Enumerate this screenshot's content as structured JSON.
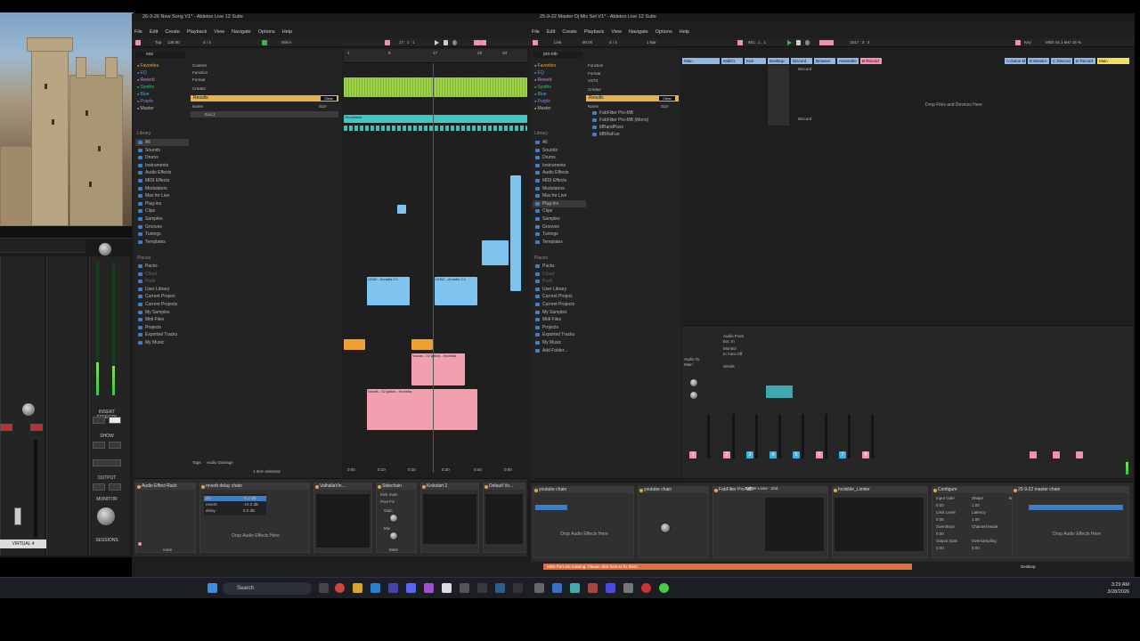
{
  "left_window": {
    "title": "26-3-26 New Song V1* - Ableton Live 12 Suite",
    "menu": [
      "File",
      "Edit",
      "Create",
      "Playback",
      "View",
      "Navigate",
      "Options",
      "Help"
    ],
    "transport": {
      "tap": "Tap",
      "tempo": "138.00",
      "meter": "4 / 4",
      "position": "17 . 1 . 1",
      "scale": "Minor"
    },
    "search_value": "eos",
    "collections": [
      "Favorites",
      "EQ",
      "Reverb",
      "Synths",
      "Blue",
      "Purple",
      "Master"
    ],
    "library_head": "Library",
    "library": [
      "All",
      "Sounds",
      "Drums",
      "Instruments",
      "Audio Effects",
      "MIDI Effects",
      "Modulators",
      "Max for Live",
      "Plug-ins",
      "Clips",
      "Samples",
      "Grooves",
      "Tunings",
      "Templates"
    ],
    "places_head": "Places",
    "places": [
      "Packs",
      "Cloud",
      "Push",
      "User Library",
      "Current Project",
      "Current Projects",
      "My Samples",
      "Midi Files",
      "Projects",
      "Exported Tracks",
      "My Music"
    ],
    "filter_items": [
      "Content",
      "Function",
      "Format",
      "Creator"
    ],
    "results_label": "Results",
    "result_item": "Name",
    "result_row": "Eos 2",
    "clear_label": "Clear",
    "size_label": "Size",
    "tags_label": "Tags",
    "tags_value": "Audio Damage",
    "status_text": "1 Item selected",
    "ruler": [
      "1",
      "9",
      "17",
      "25",
      "33"
    ],
    "time_ticks": [
      "0:00",
      "0:10",
      "0:20",
      "0:30",
      "0:40",
      "0:50"
    ],
    "clip_ghost": "Ghosttrack",
    "clip_lead": "LEAD - Arcadia 2.1",
    "clip_vocals": "Vocals - 02 gallos - muestra",
    "clip_vocals2": "Vocals - 02 gallos - muestra",
    "device_chain_label": "reverb delay chain",
    "devices": [
      "Audio Effect Rack",
      "reverb delay chain",
      "ValhallaVin...",
      "Sidechain",
      "Kickstart 2",
      "Default Vo..."
    ],
    "drop_msg": "Drop Audio Effects Here",
    "dev_params": [
      "dry",
      "reverb",
      "delay"
    ],
    "dev_values": [
      "-6.2 dB",
      "-10.2 dB",
      "0.0 dB"
    ],
    "sidechain_labels": [
      "Sidechain",
      "Kick main",
      "Post FX",
      "Gain",
      "Mix",
      "Mute"
    ],
    "none_label": "none"
  },
  "right_window": {
    "title": "25-9-22 Master Dj Mix Set V1* - Ableton Live 12 Suite",
    "menu": [
      "File",
      "Edit",
      "Create",
      "Playback",
      "View",
      "Navigate",
      "Options",
      "Help"
    ],
    "transport": {
      "tap": "Link",
      "tempo": "90.00",
      "meter": "4 / 4",
      "bar": "1 Bar",
      "position": "651 . 1 . 1",
      "position2": "1517 . 3 . 4",
      "key": "Key",
      "sample": "MIDI 44.1 kHz 16 %"
    },
    "search_value": "pro-mb",
    "collections": [
      "Favorites",
      "EQ",
      "Reverb",
      "Synths",
      "Blue",
      "Purple",
      "Master"
    ],
    "library": [
      "All",
      "Sounds",
      "Drums",
      "Instruments",
      "Audio Effects",
      "MIDI Effects",
      "Modulators",
      "Max for Live",
      "Plug-ins",
      "Clips",
      "Samples",
      "Grooves",
      "Tunings",
      "Templates"
    ],
    "places": [
      "Packs",
      "Cloud",
      "Push",
      "User Library",
      "Current Project",
      "Current Projects",
      "My Samples",
      "Midi Files",
      "Projects",
      "Exported Tracks",
      "My Music",
      "Add Folder..."
    ],
    "results": [
      "FabFilter Pro-MB",
      "FabFilter Pro-MB (Mono)",
      "MBandPass",
      "MBRaFun"
    ],
    "filter_items": [
      "Function",
      "Format",
      "VST3",
      "Creator"
    ],
    "tracks": [
      "Main",
      "MidiGr",
      "Kick",
      "Desktop",
      "Discord",
      "Browser",
      "Assemble",
      "B Record"
    ],
    "return_tracks": [
      "A Game M",
      "B Monitor",
      "C Discord",
      "D Record",
      "Main"
    ],
    "track_nums": [
      "1",
      "2",
      "3",
      "4",
      "5",
      "6",
      "7",
      "8"
    ],
    "drop_files": "Drop Files and Devices Here",
    "io_labels": [
      "Audio From",
      "Ext. In",
      "Monitor",
      "In Auto Off",
      "Audio To",
      "Main",
      "Sends"
    ],
    "clip_label": "Discord",
    "devices": [
      "youtube chain",
      "FabFilter Pro-MB",
      "Tighter Lows - Zed",
      "Invisible_Limiter",
      "Configure",
      "25-9-22 master chain"
    ],
    "drop_msg": "Drop Audio Effects Here",
    "limiter_labels": [
      "Input Gain",
      "Limit Level",
      "Overshoot",
      "Output Gain",
      "Shape",
      "Latency",
      "Channel Mode",
      "Oversampling",
      "Bypass"
    ],
    "limiter_values": [
      "0.00",
      "0.00",
      "0.00",
      "0.00",
      "1.00",
      "1.00",
      "0.00"
    ],
    "status_bar": "MIDI Port are missing. Please click here to fix them.",
    "status_right": "Desktop"
  },
  "ua_console": {
    "labels": [
      "INSERT EFFECTS",
      "SHOW",
      "OUTPUT",
      "MONITOR",
      "SESSIONS",
      "VIRTUAL 4"
    ],
    "meter_levels": [
      0.45,
      0.55
    ]
  },
  "taskbar": {
    "search_placeholder": "Search",
    "time": "3:29 AM",
    "date": "3/28/2026",
    "icons": [
      "start-icon",
      "widgets-icon",
      "chrome-icon",
      "file-explorer-icon",
      "edge-icon",
      "store-icon",
      "discord-icon",
      "steam-icon",
      "ableton-icon",
      "mail-icon",
      "settings-icon",
      "terminal-icon"
    ]
  },
  "colors": {
    "accent_yellow": "#e6b34a",
    "green_clip": "#9fd445",
    "blue_clip": "#7ec4ee",
    "pink_clip": "#f2a0b0",
    "cyan_clip": "#42c8c4",
    "orange": "#f0a030",
    "pink_track": "#f78fb3",
    "track_blue": "#3db4e0"
  }
}
